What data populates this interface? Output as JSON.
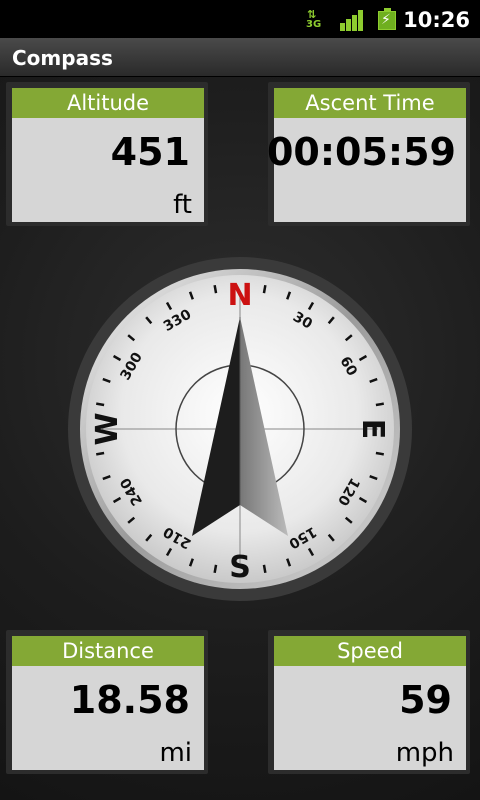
{
  "status_bar": {
    "network_type": "3G",
    "network_icon": "network-3g-icon",
    "signal_icon": "signal-strength-icon",
    "battery_icon": "battery-charging-icon",
    "time": "10:26",
    "accent_color": "#8ecc2f"
  },
  "app": {
    "title": "Compass"
  },
  "cards": {
    "altitude": {
      "label": "Altitude",
      "value": "451",
      "unit": "ft"
    },
    "ascent_time": {
      "label": "Ascent Time",
      "value": "00:05:59"
    },
    "distance": {
      "label": "Distance",
      "value": "18.58",
      "unit": "mi"
    },
    "speed": {
      "label": "Speed",
      "value": "59",
      "unit": "mph"
    }
  },
  "compass": {
    "cardinals": {
      "north": "N",
      "east": "E",
      "south": "S",
      "west": "W"
    },
    "degree_labels": [
      "30",
      "60",
      "120",
      "150",
      "210",
      "240",
      "300",
      "330"
    ],
    "heading_degrees": 0,
    "north_color": "#cc1111"
  },
  "colors": {
    "card_header": "#84a835",
    "card_body": "#d6d6d6"
  }
}
